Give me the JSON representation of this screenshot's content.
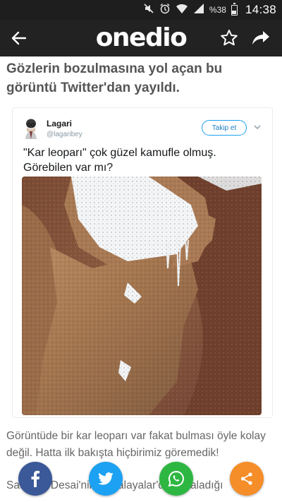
{
  "status_bar": {
    "battery_percent": "%38",
    "time": "14:38",
    "icons": [
      "mute-icon",
      "alarm-icon",
      "wifi-icon",
      "signal-icon",
      "battery-icon"
    ]
  },
  "app_bar": {
    "logo_text": "onedio",
    "icons": [
      "back-arrow-icon",
      "star-icon",
      "share-icon"
    ]
  },
  "article": {
    "headline": "Gözlerin bozulmasına yol açan bu görüntü Twitter'dan yayıldı.",
    "paragraph_1": "Görüntüde bir kar leoparı var fakat bulması öyle kolay değil. Hatta ilk bakışta hiçbirimiz göremedik!",
    "paragraph_2_visible": "Saurabh Desai'nin Himalayalar'da yakaladığı"
  },
  "tweet": {
    "name": "Lagari",
    "handle": "@lagaribey",
    "follow_label": "Takip et",
    "text": "\"Kar leoparı\" çok güzel kamufle olmuş. Görebilen var mı?",
    "accent_color": "#1da1f2"
  },
  "share_bar": {
    "buttons": [
      {
        "name": "facebook",
        "color": "#3b5998"
      },
      {
        "name": "twitter",
        "color": "#1da1f2"
      },
      {
        "name": "whatsapp",
        "color": "#2db742"
      },
      {
        "name": "share",
        "color": "#f58d28"
      }
    ]
  },
  "colors": {
    "status_bar": "#1e1e1e",
    "app_bar": "#222222",
    "headline": "#555555",
    "body_text": "#666666"
  }
}
